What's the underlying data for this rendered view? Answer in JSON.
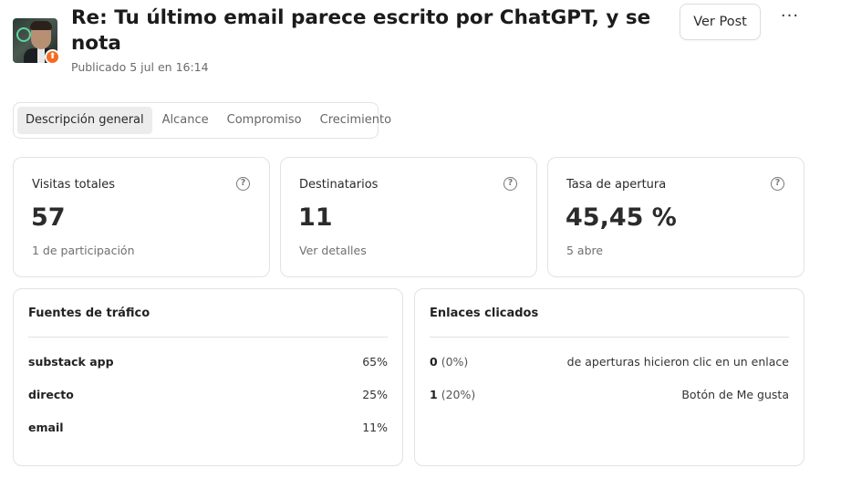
{
  "header": {
    "title": "Re: Tu último email parece escrito por ChatGPT, y se nota",
    "published": "Publicado 5 jul en 16:14",
    "ver_post_label": "Ver Post",
    "more_label": "···"
  },
  "tabs": [
    {
      "label": "Descripción general",
      "active": true
    },
    {
      "label": "Alcance",
      "active": false
    },
    {
      "label": "Compromiso",
      "active": false
    },
    {
      "label": "Crecimiento",
      "active": false
    }
  ],
  "stats": [
    {
      "label": "Visitas totales",
      "value": "57",
      "sub": "1 de participación"
    },
    {
      "label": "Destinatarios",
      "value": "11",
      "sub": "Ver detalles"
    },
    {
      "label": "Tasa de apertura",
      "value": "45,45 %",
      "sub": "5 abre"
    }
  ],
  "help_glyph": "?",
  "traffic": {
    "title": "Fuentes de tráfico",
    "rows": [
      {
        "source": "substack app",
        "pct": "65%"
      },
      {
        "source": "directo",
        "pct": "25%"
      },
      {
        "source": "email",
        "pct": "11%"
      }
    ]
  },
  "links": {
    "title": "Enlaces clicados",
    "rows": [
      {
        "count": "0",
        "pct": "(0%)",
        "desc": "de aperturas hicieron clic en un enlace"
      },
      {
        "count": "1",
        "pct": "(20%)",
        "desc": "Botón de Me gusta"
      }
    ]
  },
  "colors": {
    "accent_badge": "#f26d21",
    "border": "#e2e2e2",
    "active_tab_bg": "#ececec"
  },
  "icons": {
    "badge": "pin-icon",
    "help": "help-circle-icon",
    "more": "more-horizontal-icon"
  }
}
